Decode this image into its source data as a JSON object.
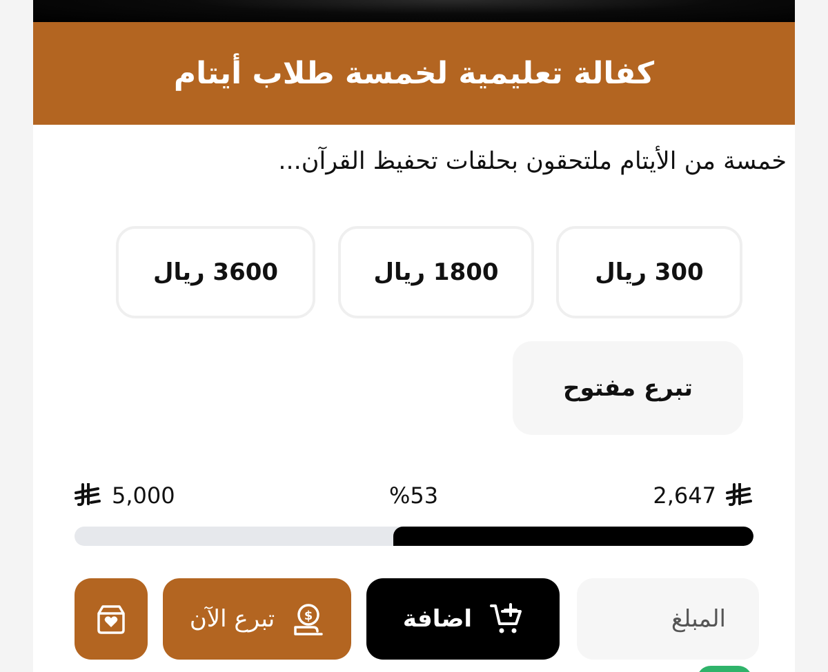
{
  "project": {
    "title": "كفالة تعليمية لخمسة طلاب أيتام",
    "description": "خمسة من الأيتام ملتحقون بحلقات تحفيظ القرآن..."
  },
  "amount_options": [
    {
      "label": "300 ريال"
    },
    {
      "label": "1800 ريال"
    },
    {
      "label": "3600 ريال"
    }
  ],
  "open_donation": {
    "label": "تبرع مفتوح"
  },
  "progress": {
    "collected": "2,647",
    "percent_label": "%53",
    "target": "5,000",
    "fraction": 0.53
  },
  "actions": {
    "amount_placeholder": "المبلغ",
    "add_label": "اضافة",
    "donate_label": "تبرع الآن"
  },
  "colors": {
    "brand": "#b36521",
    "dark": "#000000",
    "track": "#e6e8ec"
  },
  "icons": {
    "currency": "saudi-riyal-icon",
    "add": "cart-plus-icon",
    "donate": "coin-hand-icon",
    "gift": "gift-box-heart-icon"
  }
}
